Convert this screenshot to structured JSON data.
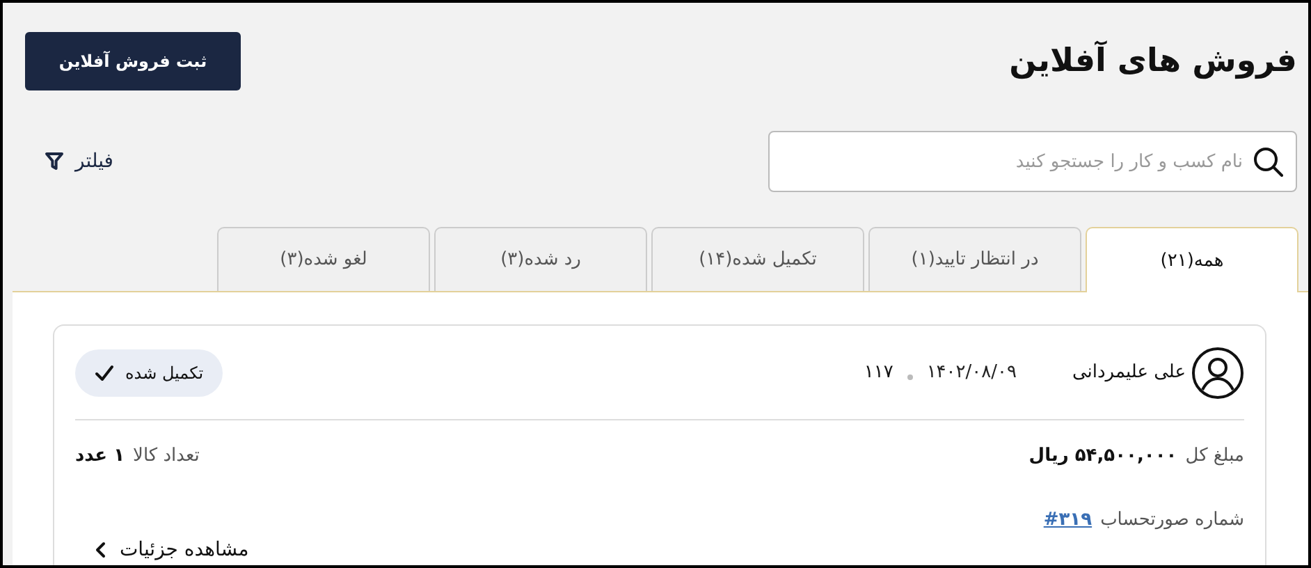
{
  "page": {
    "title": "فروش های آفلاین",
    "primary_button": "ثبت فروش آفلاین"
  },
  "search": {
    "placeholder": "نام کسب و کار را جستجو کنید"
  },
  "filter": {
    "label": "فیلتر"
  },
  "tabs": [
    {
      "label": "همه(۲۱)",
      "selected": true
    },
    {
      "label": "در انتظار تایید(۱)",
      "selected": false
    },
    {
      "label": "تکمیل شده(۱۴)",
      "selected": false
    },
    {
      "label": "رد شده(۳)",
      "selected": false
    },
    {
      "label": "لغو شده(۳)",
      "selected": false
    }
  ],
  "orders": [
    {
      "customer": "علی علیمردانی",
      "date": "۱۴۰۲/۰۸/۰۹",
      "code": "۱۱۷",
      "status": "تکمیل شده",
      "total_label": "مبلغ کل",
      "total": "۵۴,۵۰۰,۰۰۰ ریال",
      "items_label": "تعداد کالا",
      "items": "۱ عدد",
      "invoice_label": "شماره صورتحساب",
      "invoice": "#۳۱۹",
      "details_link": "مشاهده جزئیات"
    }
  ]
}
